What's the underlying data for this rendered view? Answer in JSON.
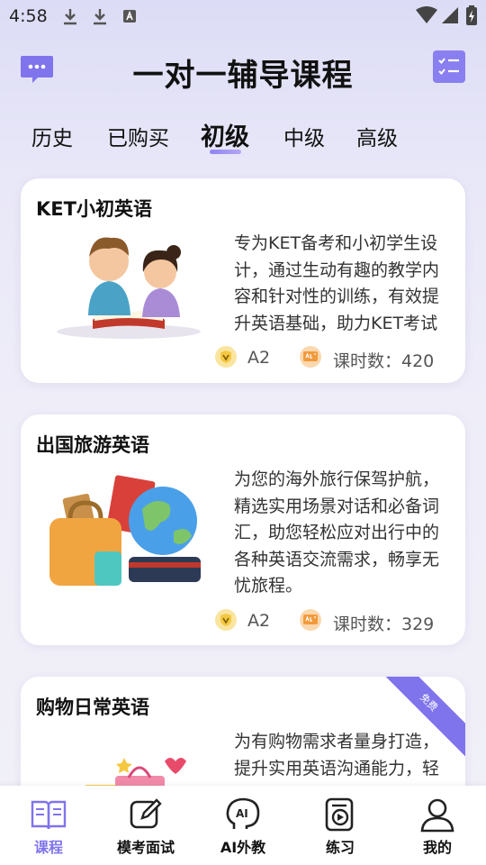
{
  "status_bar": {
    "time": "4:58"
  },
  "header": {
    "title": "一对一辅导课程"
  },
  "tabs": [
    {
      "label": "历史"
    },
    {
      "label": "已购买"
    },
    {
      "label": "初级",
      "active": true
    },
    {
      "label": "中级"
    },
    {
      "label": "高级"
    }
  ],
  "courses": [
    {
      "title": "KET小初英语",
      "desc": "专为KET备考和小初学生设计，通过生动有趣的教学内容和针对性的训练，有效提升英语基础，助力KET考试",
      "level": "A2",
      "lessons": "课时数：420",
      "image": "children-reading-illustration"
    },
    {
      "title": "出国旅游英语",
      "desc": "为您的海外旅行保驾护航，精选实用场景对话和必备词汇，助您轻松应对出行中的各种英语交流需求，畅享无忧旅程。",
      "level": "A2",
      "lessons": "课时数：329",
      "image": "luggage-globe-illustration"
    },
    {
      "title": "购物日常英语",
      "desc": "为有购物需求者量身打造，提升实用英语沟通能力，轻",
      "badge": "免费",
      "image": "shopping-bags-illustration"
    }
  ],
  "bottom_nav": [
    {
      "label": "课程",
      "icon": "book-icon",
      "active": true
    },
    {
      "label": "模考面试",
      "icon": "edit-icon"
    },
    {
      "label": "AI外教",
      "icon": "ai-head-icon"
    },
    {
      "label": "练习",
      "icon": "play-doc-icon"
    },
    {
      "label": "我的",
      "icon": "person-icon"
    }
  ],
  "colors": {
    "accent": "#7f74ec",
    "level_badge": "#f5c842",
    "lessons_badge": "#f29a3c"
  }
}
